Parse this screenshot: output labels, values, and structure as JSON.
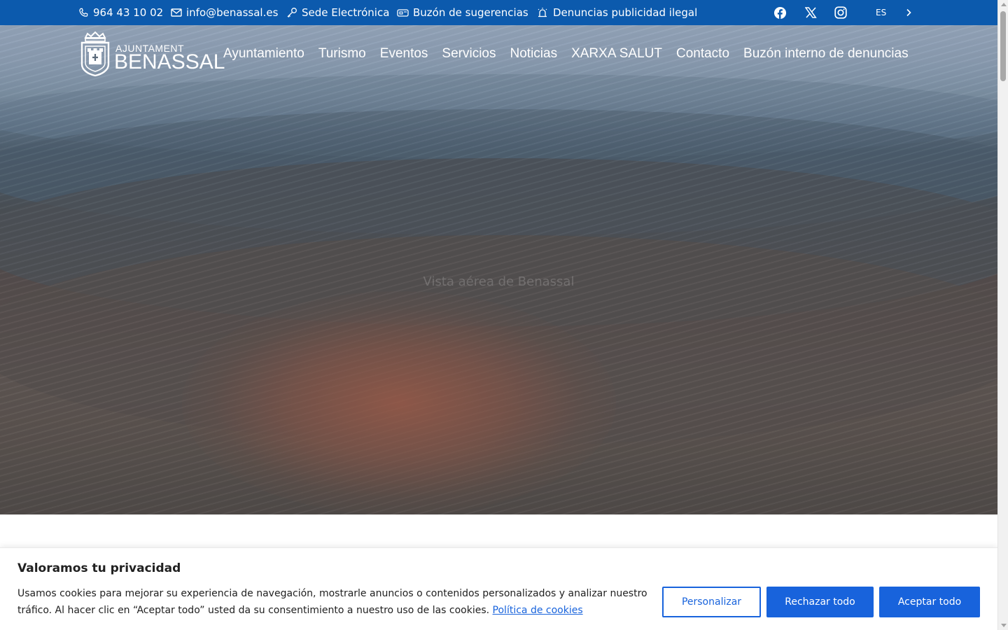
{
  "topbar": {
    "phone": "964 43 10 02",
    "email": "info@benassal.es",
    "sede": "Sede Electrónica",
    "buzon": "Buzón de sugerencias",
    "denuncias": "Denuncias publicidad ilegal",
    "lang": "ES",
    "social": [
      "facebook-icon",
      "x-icon",
      "instagram-icon"
    ]
  },
  "logo": {
    "line1": "AJUNTAMENT",
    "line2": "BENASSAL"
  },
  "nav": {
    "items": [
      "Ayuntamiento",
      "Turismo",
      "Eventos",
      "Servicios",
      "Noticias",
      "XARXA SALUT",
      "Contacto",
      "Buzón interno de denuncias"
    ]
  },
  "hero": {
    "caption": "Vista aérea de Benassal"
  },
  "cookie": {
    "title": "Valoramos tu privacidad",
    "text": "Usamos cookies para mejorar su experiencia de navegación, mostrarle anuncios o contenidos personalizados y analizar nuestro tráfico. Al hacer clic en “Aceptar todo” usted da su consentimiento a nuestro uso de las cookies.",
    "link": "Política de cookies",
    "customize": "Personalizar",
    "reject": "Rechazar todo",
    "accept": "Aceptar todo"
  },
  "colors": {
    "topbar": "#0c5aad",
    "accent": "#1863dc"
  }
}
